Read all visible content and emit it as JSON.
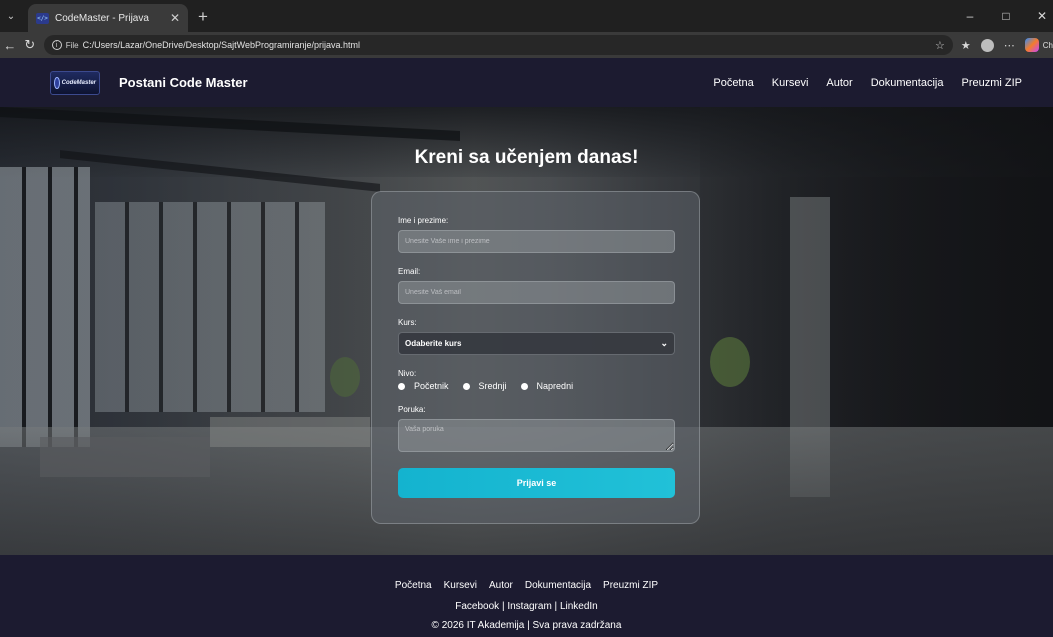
{
  "browser": {
    "tab_title": "CodeMaster - Prijava",
    "url_scheme": "File",
    "url": "C:/Users/Lazar/OneDrive/Desktop/SajtWebProgramiranje/prijava.html",
    "copilot_label": "Ch"
  },
  "header": {
    "logo_text": "CodeMaster",
    "brand": "Postani Code Master",
    "nav": [
      "Početna",
      "Kursevi",
      "Autor",
      "Dokumentacija",
      "Preuzmi ZIP"
    ]
  },
  "hero": {
    "title": "Kreni sa učenjem danas!"
  },
  "form": {
    "name_label": "Ime i prezime:",
    "name_placeholder": "Unesite Vaše ime i prezime",
    "email_label": "Email:",
    "email_placeholder": "Unesite Vaš email",
    "course_label": "Kurs:",
    "course_selected": "Odaberite kurs",
    "level_label": "Nivo:",
    "levels": [
      "Početnik",
      "Srednji",
      "Napredni"
    ],
    "message_label": "Poruka:",
    "message_placeholder": "Vaša poruka",
    "submit": "Prijavi se"
  },
  "footer": {
    "nav": [
      "Početna",
      "Kursevi",
      "Autor",
      "Dokumentacija",
      "Preuzmi ZIP"
    ],
    "social": "Facebook | Instagram | LinkedIn",
    "copyright": "© 2026 IT Akademija | Sva prava zadržana"
  },
  "colors": {
    "header_bg": "#1c1b30",
    "submit_accent": "#14b3cf"
  }
}
